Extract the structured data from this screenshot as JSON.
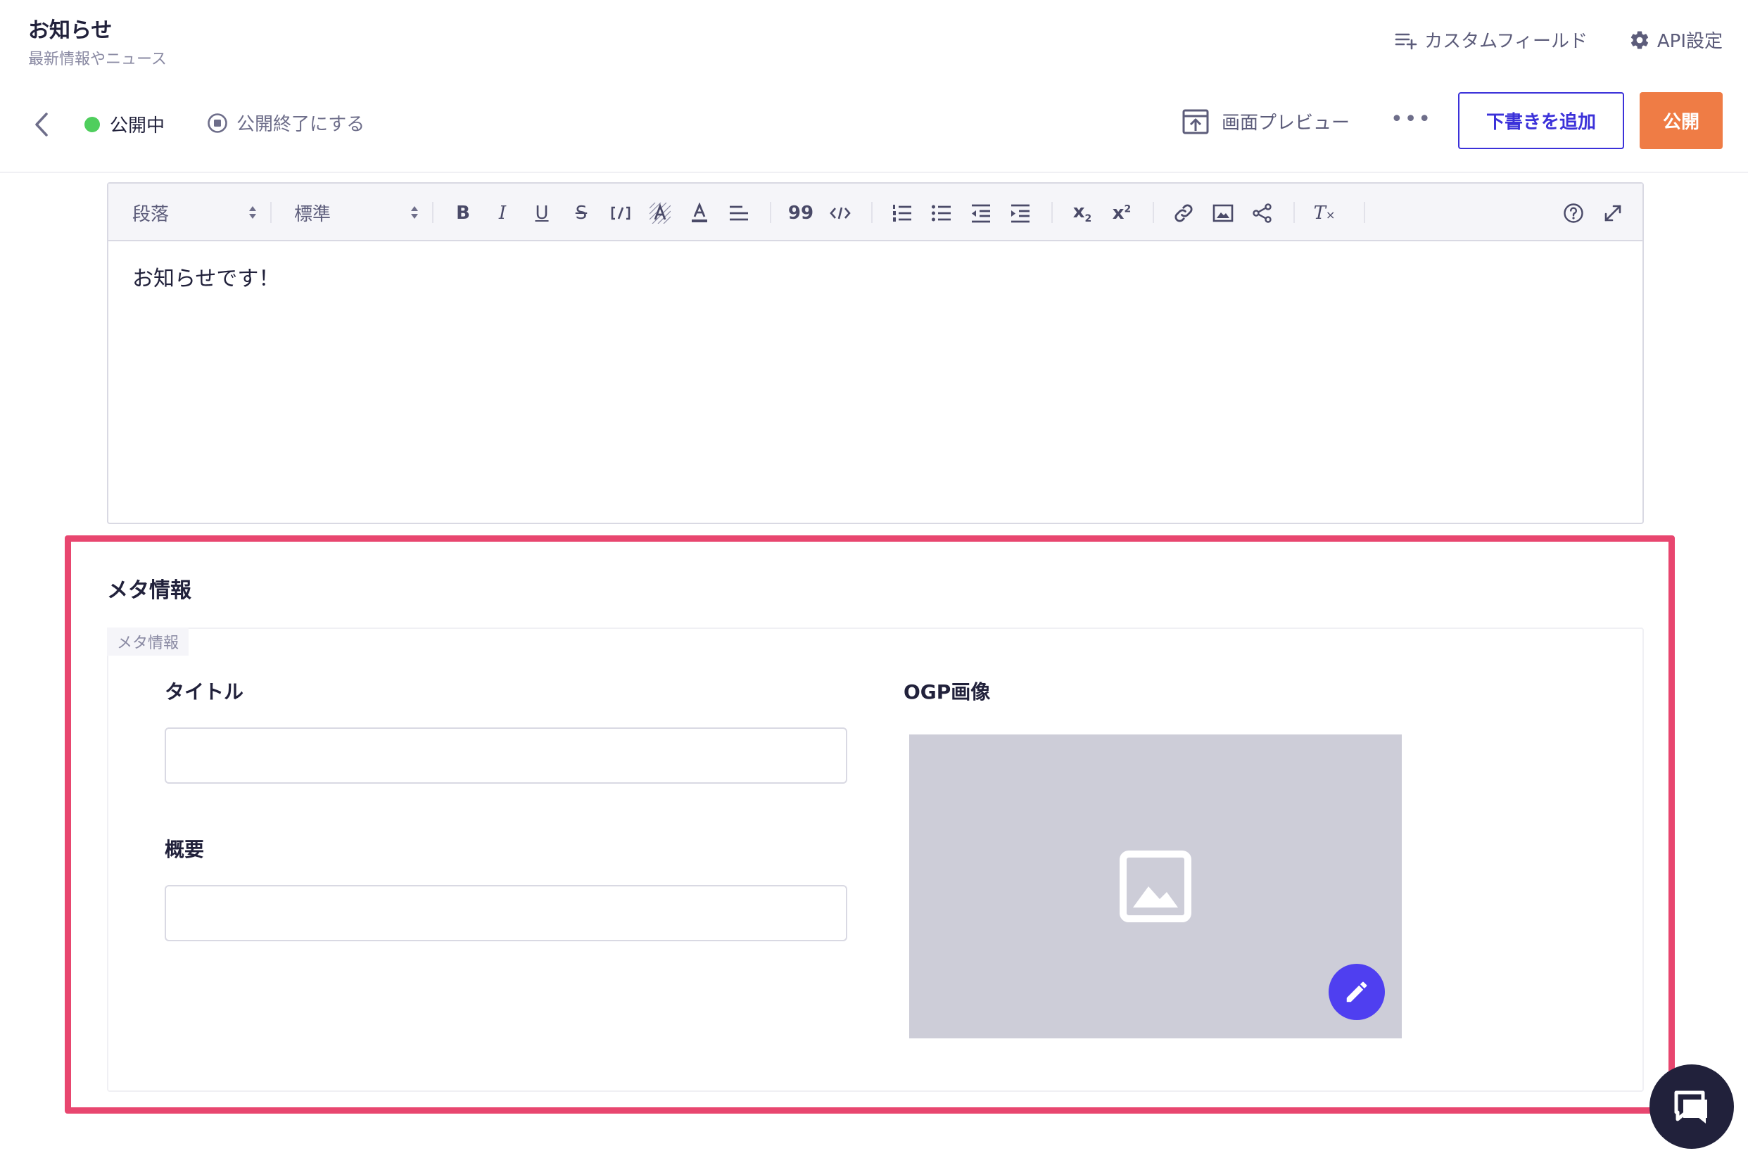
{
  "header": {
    "title": "お知らせ",
    "subtitle": "最新情報やニュース",
    "custom_fields_label": "カスタムフィールド",
    "api_settings_label": "API設定"
  },
  "status_bar": {
    "status_label": "公開中",
    "unpublish_label": "公開終了にする",
    "preview_label": "画面プレビュー",
    "more_label": "•••",
    "draft_button_label": "下書きを追加",
    "publish_button_label": "公開"
  },
  "toolbar": {
    "block_select": "段落",
    "size_select": "標準",
    "buttons": [
      "bold",
      "italic",
      "underline",
      "strikethrough",
      "inline-code",
      "background-color",
      "text-color",
      "align",
      "blockquote",
      "code-block",
      "ordered-list",
      "bullet-list",
      "outdent",
      "indent",
      "subscript",
      "superscript",
      "link",
      "image",
      "embed",
      "clear-format",
      "help",
      "fullscreen"
    ],
    "bold_glyph": "B",
    "italic_glyph": "I",
    "underline_glyph": "U",
    "strike_glyph": "S",
    "quote_glyph": "99",
    "subscript_glyph": "x",
    "subscript_mark": "2",
    "superscript_glyph": "x",
    "superscript_mark": "2",
    "clear_glyph": "T"
  },
  "editor": {
    "content": "お知らせです！"
  },
  "meta": {
    "heading": "メタ情報",
    "group_tag": "メタ情報",
    "title_label": "タイトル",
    "title_value": "",
    "summary_label": "概要",
    "summary_value": "",
    "ogp_label": "OGP画像"
  },
  "colors": {
    "accent": "#3b31d9",
    "publish": "#ef7c45",
    "status_green": "#4fce5d",
    "highlight": "#e8466f",
    "edit_button": "#4f3ff0"
  }
}
